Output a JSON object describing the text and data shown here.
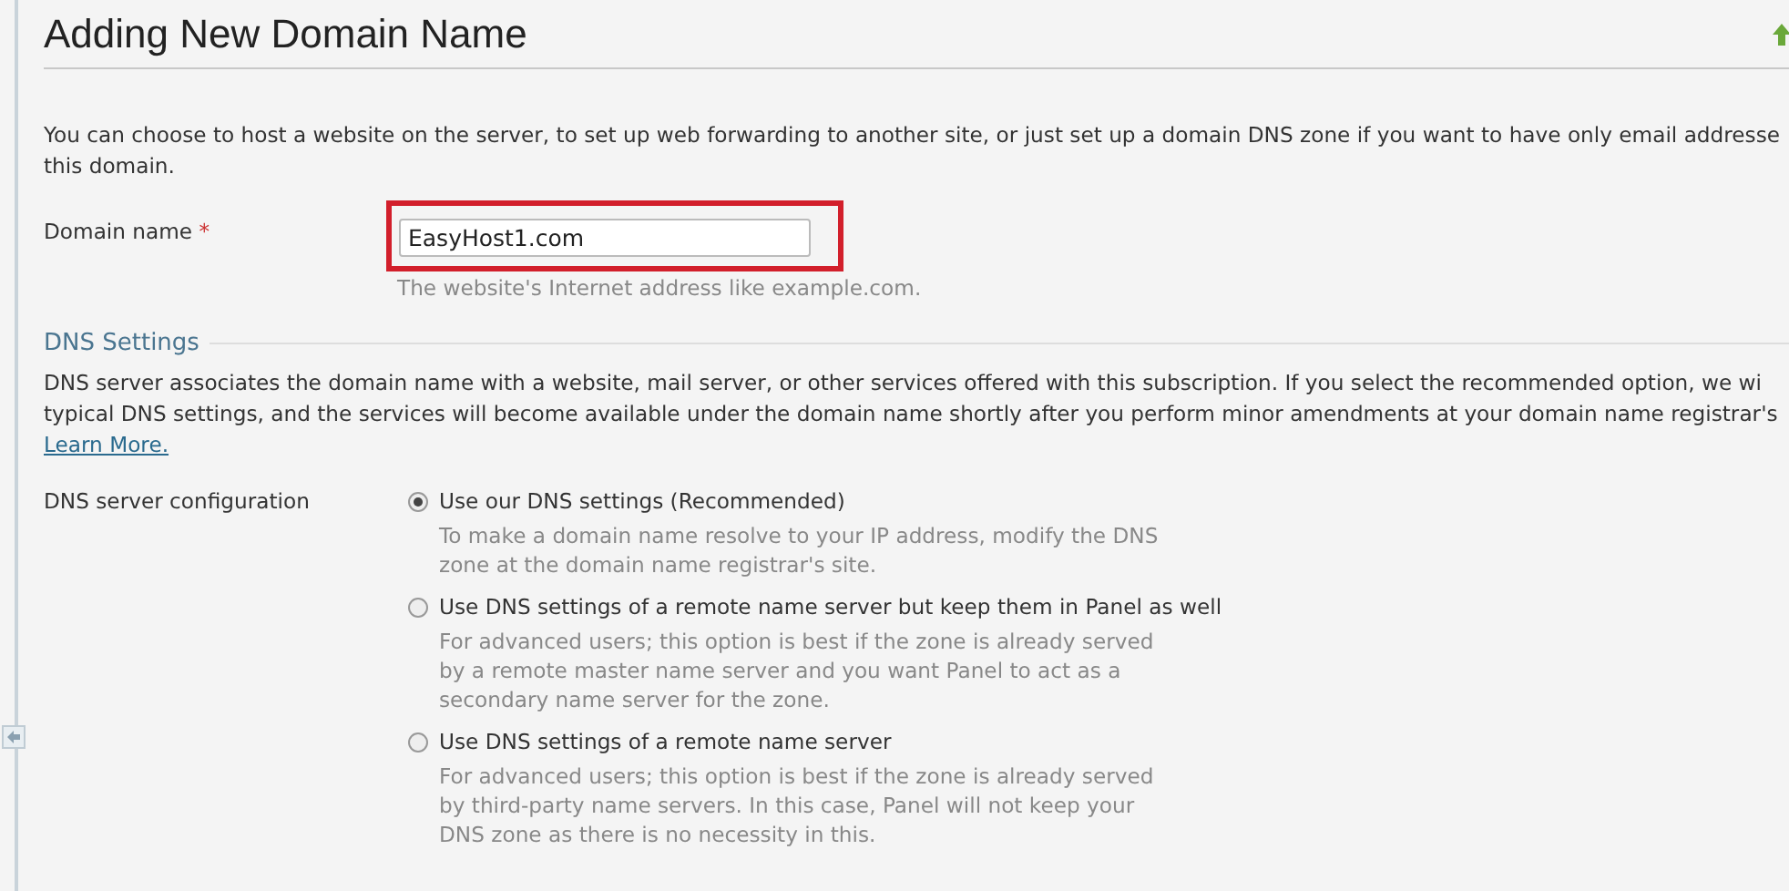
{
  "title": "Adding New Domain Name",
  "intro": [
    "You can choose to host a website on the server, to set up web forwarding to another site, or just set up a domain DNS zone if you want to have only email addresse",
    "this domain."
  ],
  "domain_field": {
    "label": "Domain name",
    "required_mark": "*",
    "value": "EasyHost1.com",
    "hint": "The website's Internet address like example.com.",
    "highlighted": true
  },
  "dns_section": {
    "title": "DNS Settings",
    "description": [
      "DNS server associates the domain name with a website, mail server, or other services offered with this subscription. If you select the recommended option, we wi",
      "typical DNS settings, and the services will become available under the domain name shortly after you perform minor amendments at your domain name registrar's"
    ],
    "link": "Learn More.",
    "config_label": "DNS server configuration",
    "options": [
      {
        "label": "Use our DNS settings (Recommended)",
        "selected": true,
        "description": [
          "To make a domain name resolve to your IP address, modify the DNS",
          "zone at the domain name registrar's site."
        ]
      },
      {
        "label": "Use DNS settings of a remote name server but keep them in Panel as well",
        "selected": false,
        "description": [
          "For advanced users; this option is best if the zone is already served",
          "by a remote master name server and you want Panel to act as a",
          "secondary name server for the zone."
        ]
      },
      {
        "label": "Use DNS settings of a remote name server",
        "selected": false,
        "description": [
          "For advanced users; this option is best if the zone is already served",
          "by third-party name servers. In this case, Panel will not keep your",
          "DNS zone as there is no necessity in this."
        ]
      }
    ]
  }
}
